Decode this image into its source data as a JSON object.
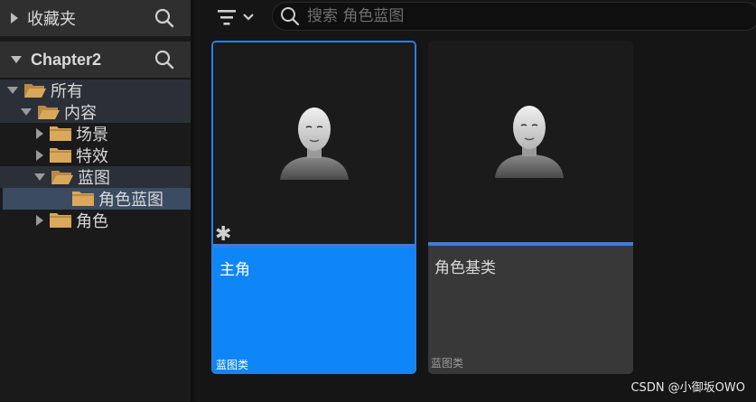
{
  "favorites": {
    "label": "收藏夹"
  },
  "project": {
    "label": "Chapter2"
  },
  "tree": [
    {
      "label": "所有"
    },
    {
      "label": "内容"
    },
    {
      "label": "场景"
    },
    {
      "label": "特效"
    },
    {
      "label": "蓝图"
    },
    {
      "label": "角色蓝图"
    },
    {
      "label": "角色"
    }
  ],
  "search": {
    "placeholder": "搜索 角色蓝图"
  },
  "assets": [
    {
      "title": "主角",
      "type": "蓝图类"
    },
    {
      "title": "角色基类",
      "type": "蓝图类"
    }
  ],
  "watermark": "CSDN @小御坂OWO",
  "colors": {
    "accent": "#0e86f8",
    "folder": "#d9a85b",
    "selection": "#3a4b62"
  },
  "icons": [
    "search-icon",
    "filter-icon",
    "chevron-down-icon",
    "folder-icon",
    "folder-open-icon",
    "character-avatar-icon",
    "asterisk-icon"
  ]
}
